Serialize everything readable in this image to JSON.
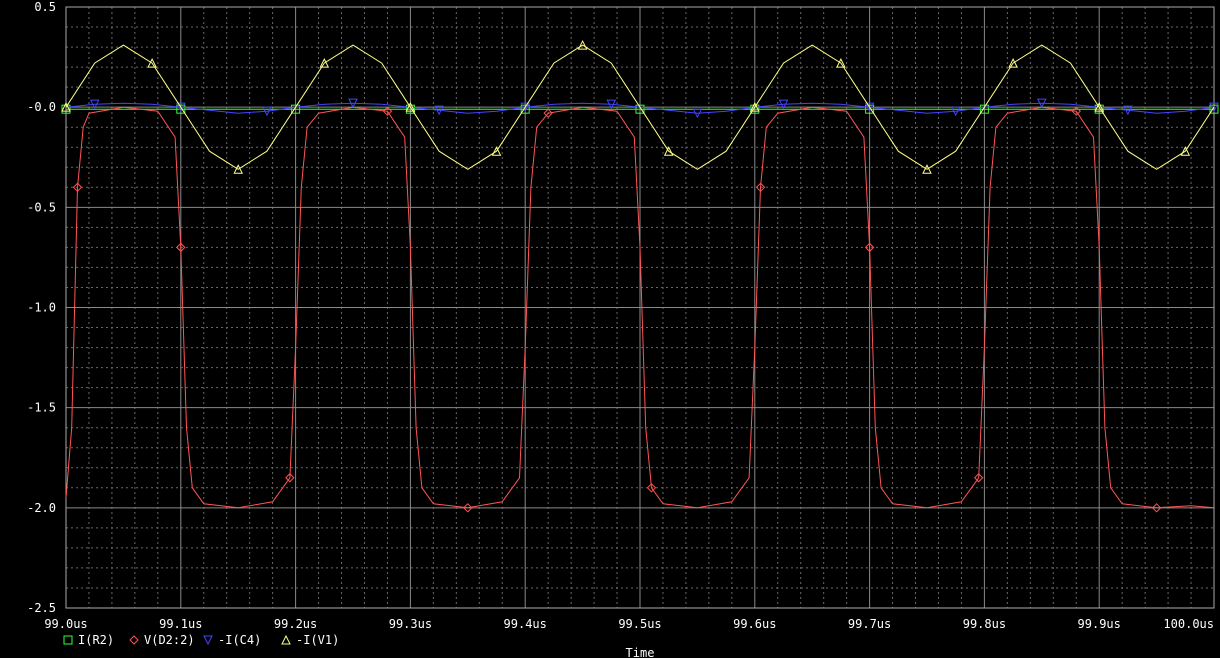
{
  "chart_data": {
    "type": "line",
    "xlabel": "Time",
    "xlim": [
      99.0,
      100.0
    ],
    "ylim": [
      -2.5,
      0.5
    ],
    "grid": true,
    "x_ticks": [
      "99.0us",
      "99.1us",
      "99.2us",
      "99.3us",
      "99.4us",
      "99.5us",
      "99.6us",
      "99.7us",
      "99.8us",
      "99.9us",
      "100.0us"
    ],
    "y_ticks": [
      "0.5",
      "-0.0",
      "-0.5",
      "-1.0",
      "-1.5",
      "-2.0",
      "-2.5"
    ],
    "series": [
      {
        "name": "I(R2)",
        "color": "#33ff33",
        "marker": "square",
        "x": [
          99.0,
          99.1,
          99.2,
          99.3,
          99.4,
          99.5,
          99.6,
          99.7,
          99.8,
          99.9,
          100.0
        ],
        "y": [
          -0.01,
          -0.01,
          -0.01,
          -0.01,
          -0.01,
          -0.01,
          -0.01,
          -0.01,
          -0.01,
          -0.01,
          -0.01
        ]
      },
      {
        "name": "V(D2:2)",
        "color": "#ff5555",
        "marker": "diamond",
        "x": [
          99.0,
          99.005,
          99.01,
          99.015,
          99.02,
          99.05,
          99.08,
          99.095,
          99.1,
          99.105,
          99.11,
          99.12,
          99.15,
          99.18,
          99.195,
          99.2,
          99.205,
          99.21,
          99.22,
          99.25,
          99.28,
          99.295,
          99.3,
          99.305,
          99.31,
          99.32,
          99.35,
          99.38,
          99.395,
          99.4,
          99.405,
          99.41,
          99.42,
          99.45,
          99.48,
          99.495,
          99.5,
          99.505,
          99.51,
          99.52,
          99.55,
          99.58,
          99.595,
          99.6,
          99.605,
          99.61,
          99.62,
          99.65,
          99.68,
          99.695,
          99.7,
          99.705,
          99.71,
          99.72,
          99.75,
          99.78,
          99.795,
          99.8,
          99.805,
          99.81,
          99.82,
          99.85,
          99.88,
          99.895,
          99.9,
          99.905,
          99.91,
          99.92,
          99.95,
          99.98,
          100.0
        ],
        "y": [
          -1.95,
          -1.6,
          -0.4,
          -0.1,
          -0.03,
          0.0,
          -0.02,
          -0.15,
          -0.7,
          -1.6,
          -1.9,
          -1.98,
          -2.0,
          -1.97,
          -1.85,
          -1.2,
          -0.4,
          -0.1,
          -0.03,
          0.0,
          -0.02,
          -0.15,
          -0.7,
          -1.6,
          -1.9,
          -1.98,
          -2.0,
          -1.97,
          -1.85,
          -1.2,
          -0.4,
          -0.1,
          -0.03,
          0.0,
          -0.02,
          -0.15,
          -0.7,
          -1.6,
          -1.9,
          -1.98,
          -2.0,
          -1.97,
          -1.85,
          -1.2,
          -0.4,
          -0.1,
          -0.03,
          0.0,
          -0.02,
          -0.15,
          -0.7,
          -1.6,
          -1.9,
          -1.98,
          -2.0,
          -1.97,
          -1.85,
          -1.2,
          -0.4,
          -0.1,
          -0.03,
          0.0,
          -0.02,
          -0.15,
          -0.7,
          -1.6,
          -1.9,
          -1.98,
          -2.0,
          -1.99,
          -2.0
        ]
      },
      {
        "name": "-I(C4)",
        "color": "#4444ff",
        "marker": "triangle-down",
        "x": [
          99.0,
          99.025,
          99.05,
          99.075,
          99.1,
          99.125,
          99.15,
          99.175,
          99.2,
          99.225,
          99.25,
          99.275,
          99.3,
          99.325,
          99.35,
          99.375,
          99.4,
          99.425,
          99.45,
          99.475,
          99.5,
          99.525,
          99.55,
          99.575,
          99.6,
          99.625,
          99.65,
          99.675,
          99.7,
          99.725,
          99.75,
          99.775,
          99.8,
          99.825,
          99.85,
          99.875,
          99.9,
          99.925,
          99.95,
          99.975,
          100.0
        ],
        "y": [
          0.0,
          0.015,
          0.02,
          0.015,
          0.0,
          -0.015,
          -0.03,
          -0.02,
          0.0,
          0.015,
          0.02,
          0.015,
          0.0,
          -0.015,
          -0.03,
          -0.02,
          0.0,
          0.015,
          0.02,
          0.015,
          0.0,
          -0.015,
          -0.03,
          -0.02,
          0.0,
          0.015,
          0.02,
          0.015,
          0.0,
          -0.015,
          -0.03,
          -0.02,
          0.0,
          0.015,
          0.02,
          0.015,
          0.0,
          -0.015,
          -0.03,
          -0.02,
          0.0
        ]
      },
      {
        "name": "-I(V1)",
        "color": "#ffff88",
        "marker": "triangle-up",
        "x": [
          99.0,
          99.025,
          99.05,
          99.075,
          99.1,
          99.125,
          99.15,
          99.175,
          99.2,
          99.225,
          99.25,
          99.275,
          99.3,
          99.325,
          99.35,
          99.375,
          99.4,
          99.425,
          99.45,
          99.475,
          99.5,
          99.525,
          99.55,
          99.575,
          99.6,
          99.625,
          99.65,
          99.675,
          99.7,
          99.725,
          99.75,
          99.775,
          99.8,
          99.825,
          99.85,
          99.875,
          99.9,
          99.925,
          99.95,
          99.975,
          100.0
        ],
        "y": [
          0.0,
          0.22,
          0.31,
          0.22,
          0.0,
          -0.22,
          -0.31,
          -0.22,
          0.0,
          0.22,
          0.31,
          0.22,
          0.0,
          -0.22,
          -0.31,
          -0.22,
          0.0,
          0.22,
          0.31,
          0.22,
          0.0,
          -0.22,
          -0.31,
          -0.22,
          0.0,
          0.22,
          0.31,
          0.22,
          0.0,
          -0.22,
          -0.31,
          -0.22,
          0.0,
          0.22,
          0.31,
          0.22,
          0.0,
          -0.22,
          -0.31,
          -0.22,
          0.0
        ]
      }
    ]
  }
}
